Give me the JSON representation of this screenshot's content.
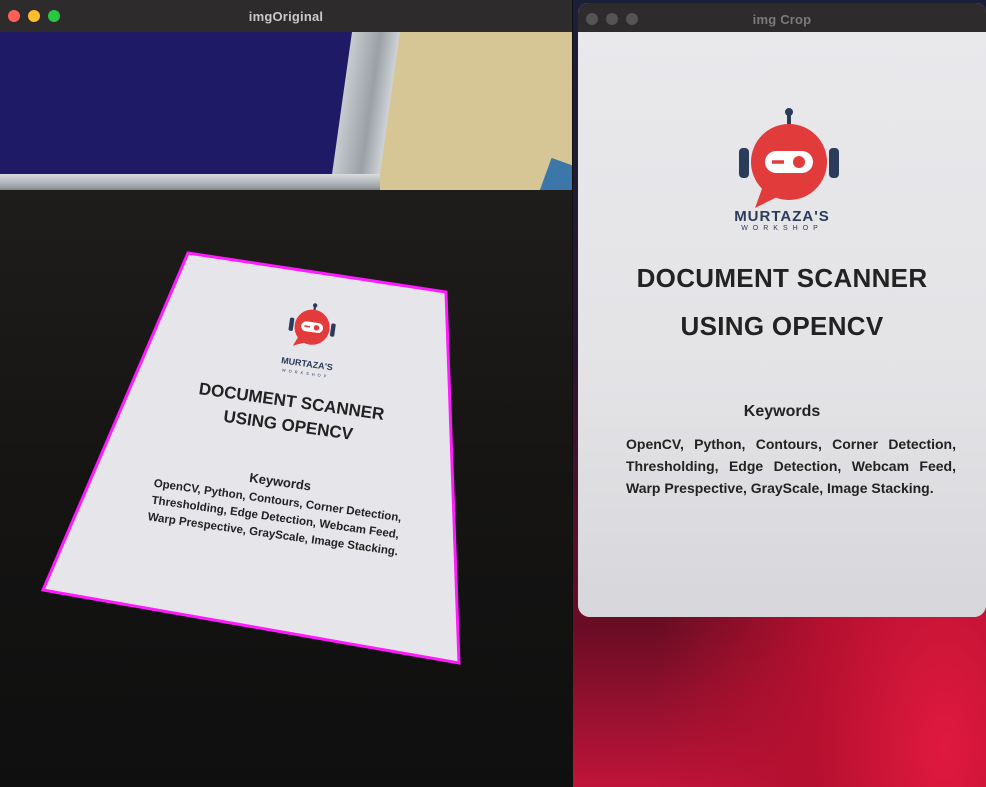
{
  "windows": {
    "original": {
      "title": "imgOriginal"
    },
    "crop": {
      "title": "img Crop"
    }
  },
  "document": {
    "logo_name": "MURTAZA'S",
    "logo_sub": "WORKSHOP",
    "title_line1": "DOCUMENT SCANNER",
    "title_line2": "USING OPENCV",
    "keywords_heading": "Keywords",
    "keywords_text": "OpenCV, Python, Contours, Corner Detection, Thresholding, Edge Detection, Webcam Feed, Warp Prespective, GrayScale, Image Stacking.",
    "keywords_line1": "OpenCV, Python, Contours, Corner Detection,",
    "keywords_line2": "Thresholding, Edge Detection, Webcam Feed,",
    "keywords_line3": "Warp Prespective, GrayScale, Image Stacking."
  },
  "colors": {
    "contour": "#ff1aff",
    "logo_red": "#e23b3b",
    "logo_dark": "#2b3b5a",
    "traffic_close": "#ff5f57",
    "traffic_min": "#febc2e",
    "traffic_max": "#28c840"
  },
  "icons": {
    "logo": "robot-chat-bubble-icon"
  }
}
